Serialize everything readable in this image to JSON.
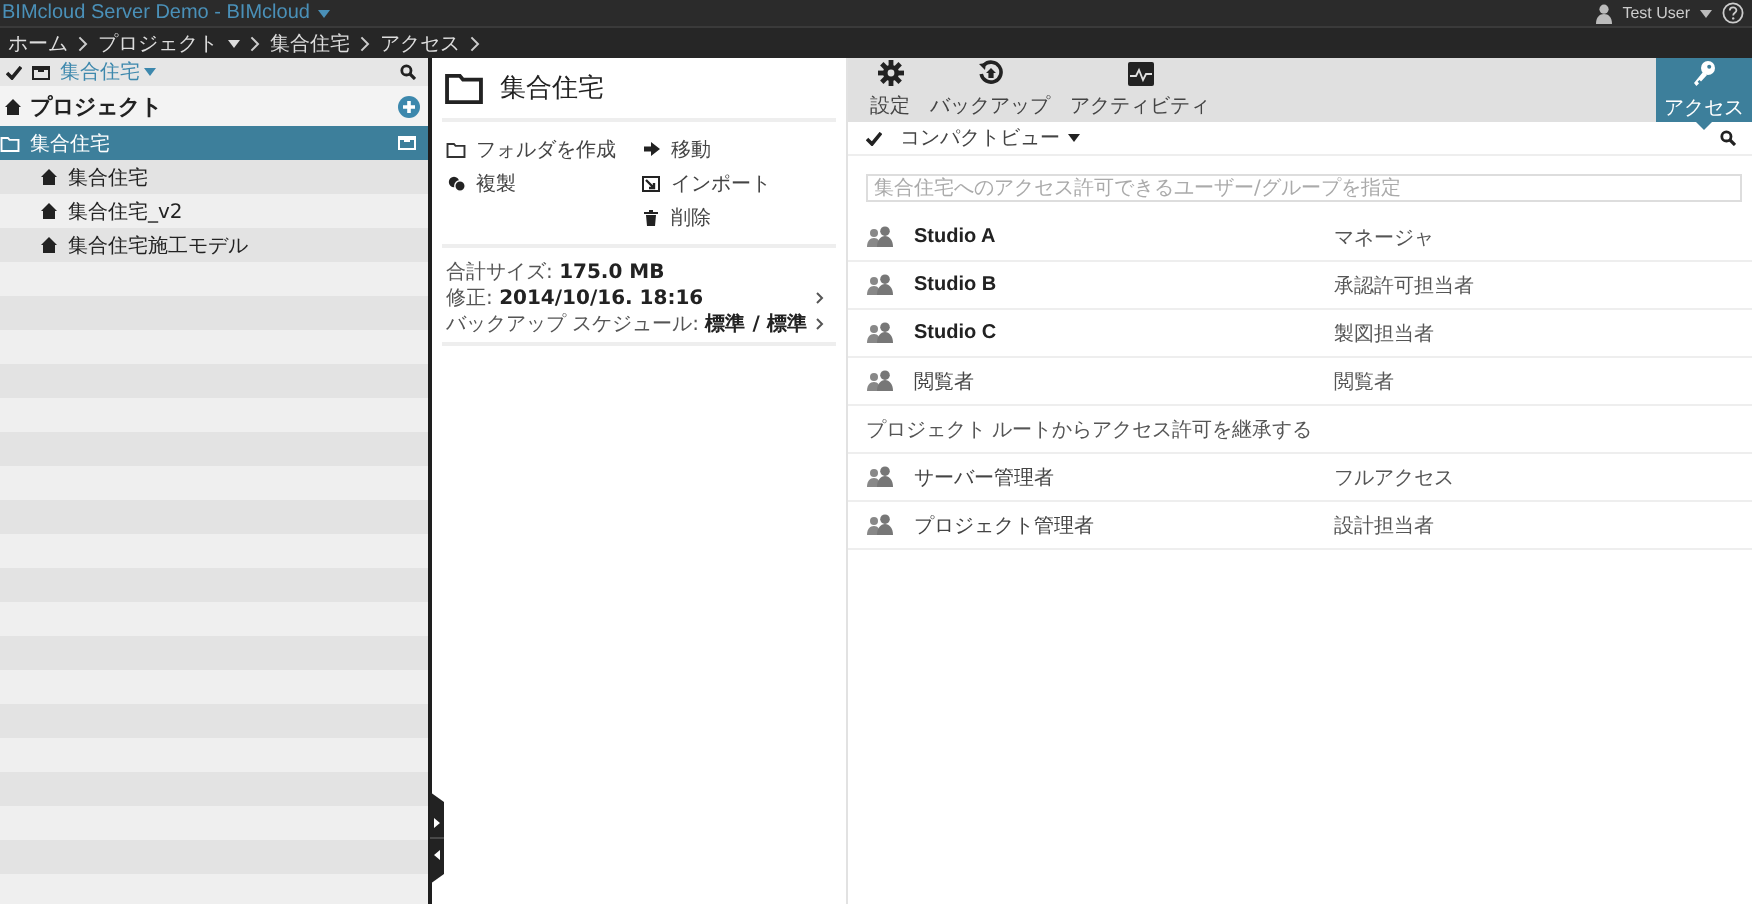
{
  "app": {
    "title": "BIMcloud Server Demo - BIMcloud",
    "user": "Test User"
  },
  "breadcrumb": [
    {
      "label": "ホーム",
      "dropdown": false
    },
    {
      "label": "プロジェクト",
      "dropdown": true
    },
    {
      "label": "集合住宅",
      "dropdown": false
    },
    {
      "label": "アクセス",
      "dropdown": false
    }
  ],
  "sidebar": {
    "filter": "集合住宅",
    "heading": "プロジェクト",
    "items": [
      {
        "label": "集合住宅",
        "kind": "folder",
        "selected": true,
        "children": [
          {
            "label": "集合住宅",
            "kind": "project",
            "selected": false
          },
          {
            "label": "集合住宅_v2",
            "kind": "project",
            "selected": false
          },
          {
            "label": "集合住宅施工モデル",
            "kind": "project",
            "selected": false
          }
        ]
      }
    ]
  },
  "details": {
    "title": "集合住宅",
    "actions_left": [
      {
        "label": "フォルダを作成",
        "kind": "folder"
      },
      {
        "label": "複製",
        "kind": "duplicate"
      }
    ],
    "actions_right": [
      {
        "label": "移動",
        "kind": "move"
      },
      {
        "label": "インポート",
        "kind": "import"
      },
      {
        "label": "削除",
        "kind": "delete"
      }
    ],
    "info": [
      {
        "text": "合計サイズ: **175.0 MB**",
        "link": false
      },
      {
        "text": "修正: **2014/10/16. 18:16**",
        "link": true
      },
      {
        "text": "バックアップ スケジュール: **標準 / 標準**",
        "link": true
      }
    ]
  },
  "toolbar": {
    "tabs": [
      {
        "label": "設定",
        "kind": "gear",
        "selected": false
      },
      {
        "label": "バックアップ",
        "kind": "backup",
        "selected": false
      },
      {
        "label": "アクティビティ",
        "kind": "activity",
        "selected": false
      },
      {
        "label": "アクセス",
        "kind": "key",
        "selected": true
      }
    ]
  },
  "access": {
    "view": "コンパクトビュー",
    "placeholder": "集合住宅へのアクセス許可できるユーザー/グループを指定",
    "entries": [
      {
        "name": "Studio A",
        "role": "マネージャ",
        "emphasis": true
      },
      {
        "name": "Studio B",
        "role": "承認許可担当者",
        "emphasis": true
      },
      {
        "name": "Studio C",
        "role": "製図担当者",
        "emphasis": true
      },
      {
        "name": "閲覧者",
        "role": "閲覧者",
        "emphasis": false
      }
    ],
    "inherit_note": "プロジェクト ルートからアクセス許可を継承する",
    "inherited": [
      {
        "name": "サーバー管理者",
        "role": "フルアクセス",
        "emphasis": false
      },
      {
        "name": "プロジェクト管理者",
        "role": "設計担当者",
        "emphasis": false
      }
    ]
  }
}
